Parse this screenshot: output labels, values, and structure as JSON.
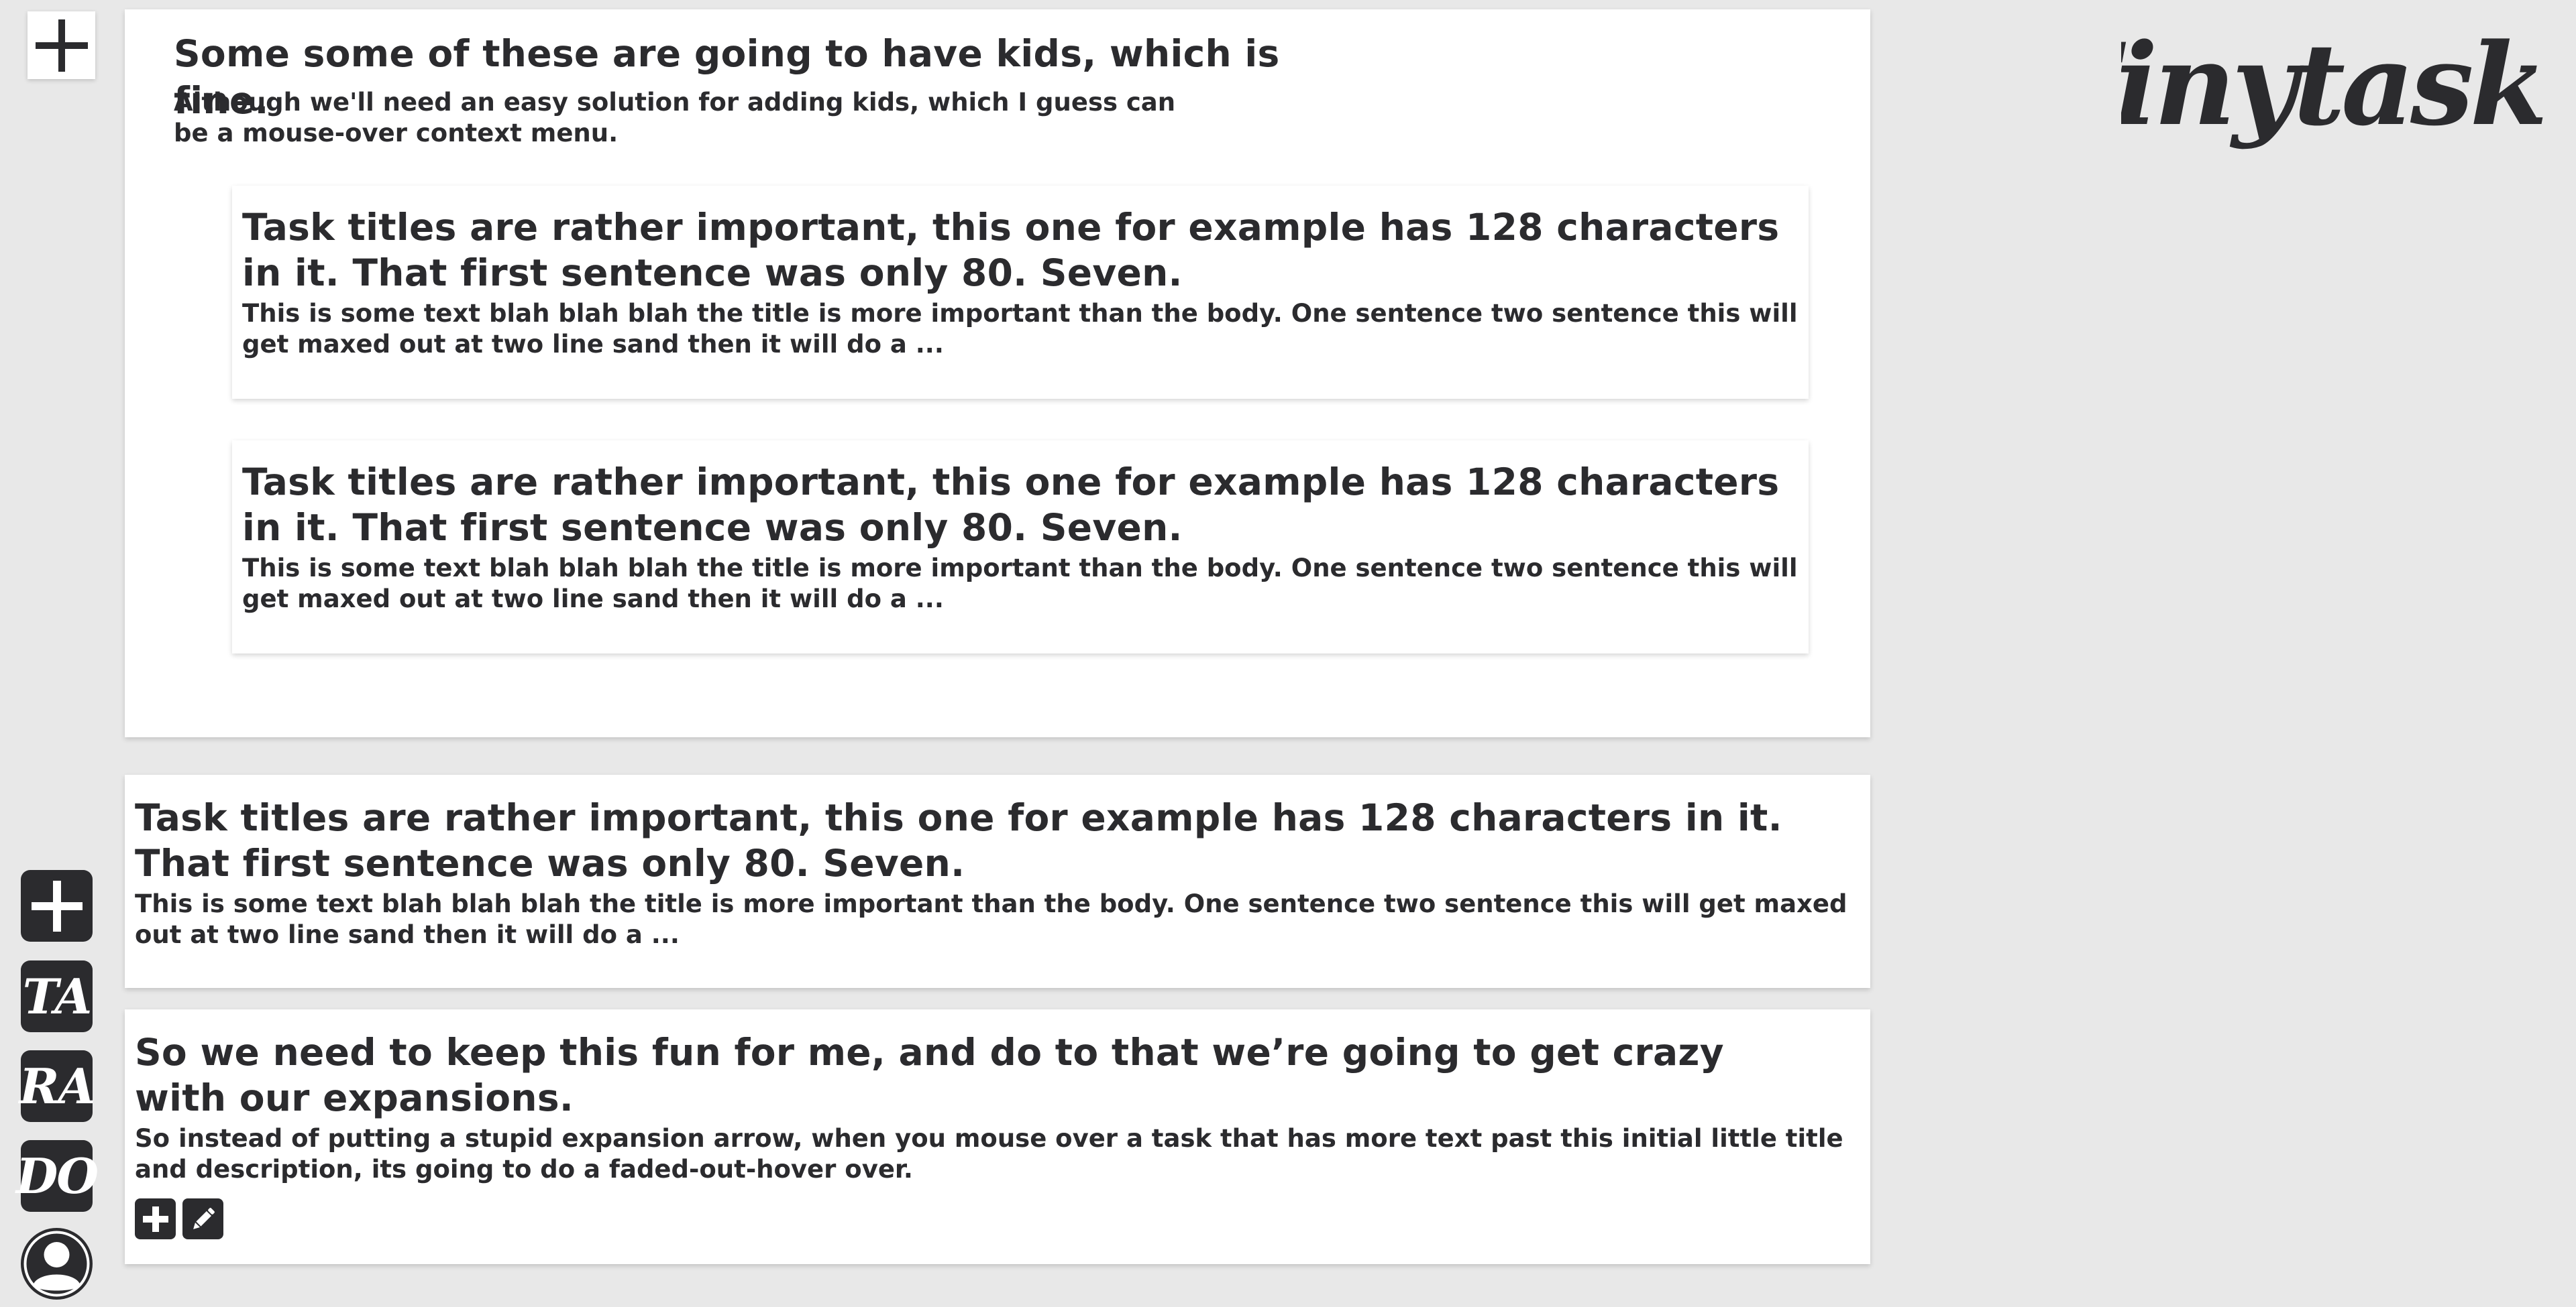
{
  "app": {
    "logo_text": "Tinytask"
  },
  "toolbar": {
    "top_add_icon": "plus-icon",
    "items": [
      {
        "icon": "plus-icon"
      },
      {
        "label": "TA"
      },
      {
        "label": "RA"
      },
      {
        "label": "DO"
      },
      {
        "icon": "user-avatar-icon"
      }
    ]
  },
  "tasks": [
    {
      "title": "Some some of these are going to have kids, which is fine.",
      "body": "Although we'll need an easy solution for adding kids, which I guess can be a mouse-over context menu.",
      "children": [
        {
          "title": "Task titles are rather important, this one for example has 128 characters in it. That first sentence was only 80. Seven.",
          "body": "This is some text blah blah blah the title is more important than the body. One sentence two sentence this will get maxed out at two line sand then it will do a ..."
        },
        {
          "title": "Task titles are rather important, this one for example has 128 characters in it. That first sentence was only 80. Seven.",
          "body": "This is some text blah blah blah the title is more important than the body. One sentence two sentence this will get maxed out at two line sand then it will do a ..."
        }
      ]
    },
    {
      "title": "Task titles are rather important, this one for example has 128 characters in it. That first sentence was only 80. Seven.",
      "body": "This is some text blah blah blah the title is more important than the body. One sentence two sentence this will get maxed out at two line sand then it will do a ..."
    },
    {
      "title": "So we need to keep this fun for me, and do to that we’re going to get crazy with our expansions.",
      "body": "So instead of putting a stupid expansion arrow, when you mouse over a task that has more text past this initial little title and description, its going to do a faded-out-hover over.",
      "actions": [
        {
          "icon": "plus-icon"
        },
        {
          "icon": "pencil-icon"
        }
      ]
    }
  ],
  "colors": {
    "background": "#e8e8e8",
    "card": "#ffffff",
    "text": "#2b2b2e"
  }
}
